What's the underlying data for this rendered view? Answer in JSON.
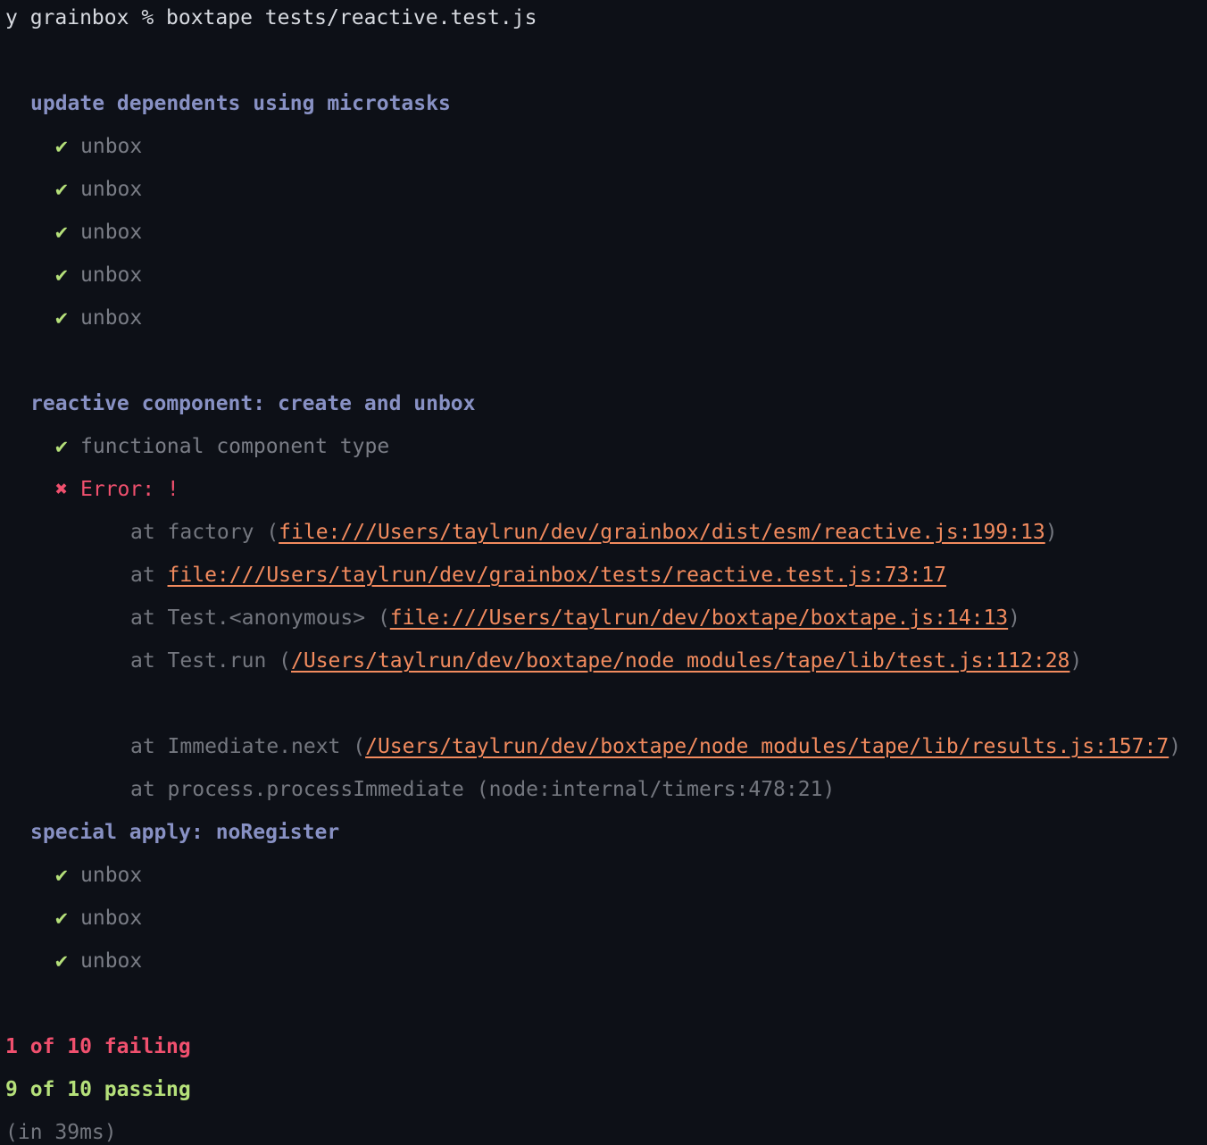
{
  "prompt": {
    "text": "y grainbox % boxtape tests/reactive.test.js"
  },
  "groups": [
    {
      "title": "update dependents using microtasks",
      "tests": [
        {
          "status": "pass",
          "icon": "check-icon",
          "mark": "✔",
          "name": "unbox"
        },
        {
          "status": "pass",
          "icon": "check-icon",
          "mark": "✔",
          "name": "unbox"
        },
        {
          "status": "pass",
          "icon": "check-icon",
          "mark": "✔",
          "name": "unbox"
        },
        {
          "status": "pass",
          "icon": "check-icon",
          "mark": "✔",
          "name": "unbox"
        },
        {
          "status": "pass",
          "icon": "check-icon",
          "mark": "✔",
          "name": "unbox"
        }
      ]
    },
    {
      "title": "reactive component: create and unbox",
      "tests": [
        {
          "status": "pass",
          "icon": "check-icon",
          "mark": "✔",
          "name": "functional component type"
        },
        {
          "status": "fail",
          "icon": "cross-icon",
          "mark": "✖",
          "name": "Error: !"
        }
      ],
      "stack": [
        {
          "prefix": "at factory (",
          "link": "file:///Users/taylrun/dev/grainbox/dist/esm/reactive.js:199:13",
          "suffix": ")"
        },
        {
          "prefix": "at ",
          "link": "file:///Users/taylrun/dev/grainbox/tests/reactive.test.js:73:17",
          "suffix": ""
        },
        {
          "prefix": "at Test.<anonymous> (",
          "link": "file:///Users/taylrun/dev/boxtape/boxtape.js:14:13",
          "suffix": ")"
        },
        {
          "prefix": "at Test.run (",
          "link": "/Users/taylrun/dev/boxtape/node_modules/tape/lib/test.js:112:28",
          "suffix": ")"
        },
        {
          "prefix": "at Immediate.next (",
          "link": "/Users/taylrun/dev/boxtape/node_modules/tape/lib/results.js:157:7",
          "suffix": ")"
        },
        {
          "prefix": "at process.processImmediate (node:internal/timers:478:21)",
          "link": "",
          "suffix": ""
        }
      ]
    },
    {
      "title": "special apply: noRegister",
      "tests": [
        {
          "status": "pass",
          "icon": "check-icon",
          "mark": "✔",
          "name": "unbox"
        },
        {
          "status": "pass",
          "icon": "check-icon",
          "mark": "✔",
          "name": "unbox"
        },
        {
          "status": "pass",
          "icon": "check-icon",
          "mark": "✔",
          "name": "unbox"
        }
      ]
    }
  ],
  "summary": {
    "failing": "1 of 10 failing",
    "passing": "9 of 10 passing",
    "timing": "(in 39ms)"
  },
  "colors": {
    "background": "#0d1017",
    "group_title": "#8891c4",
    "pass": "#b5e07a",
    "fail": "#f0506e",
    "link": "#f28b5e",
    "dim": "#74777f"
  }
}
